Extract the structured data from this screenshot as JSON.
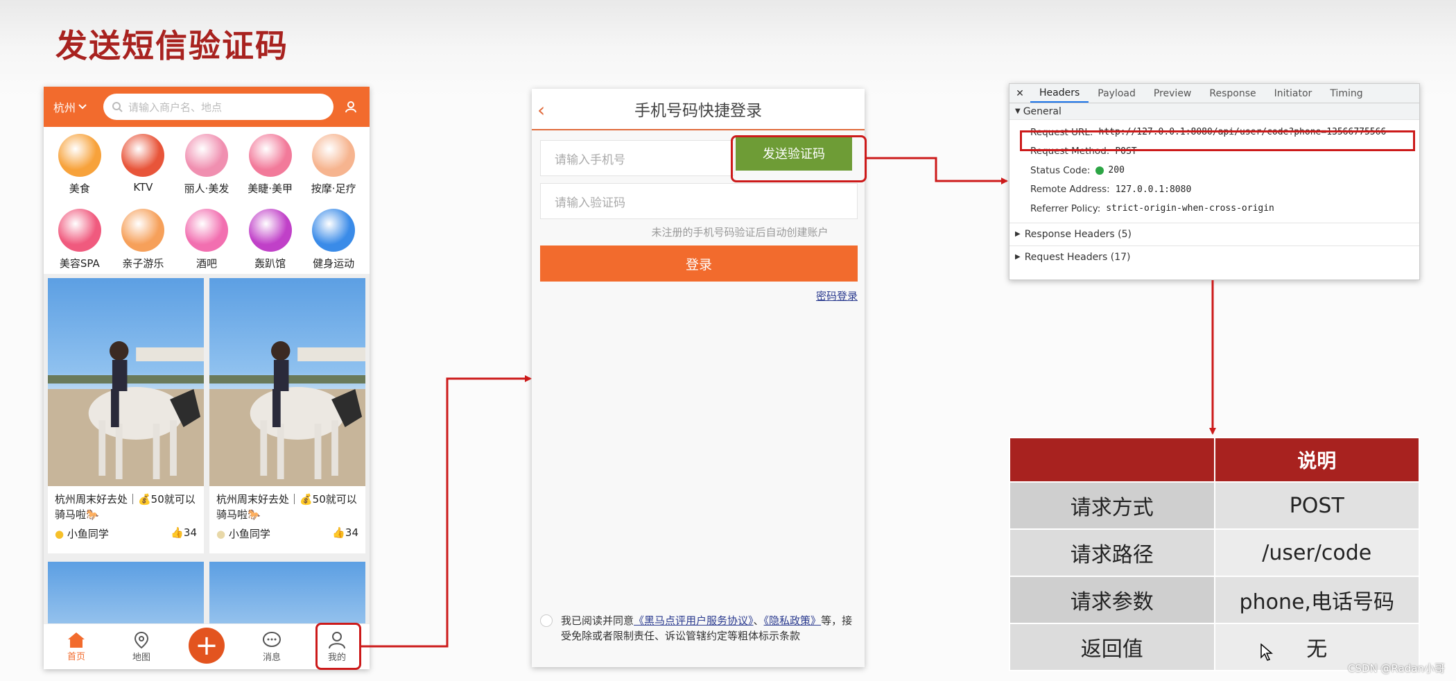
{
  "slide": {
    "title": "发送短信验证码"
  },
  "app_home": {
    "city": "杭州",
    "search_placeholder": "请输入商户名、地点",
    "categories": [
      {
        "label": "美食",
        "icon": "roast-chicken-icon",
        "color": "#f7a23b"
      },
      {
        "label": "KTV",
        "icon": "microphone-icon",
        "color": "#e8553a"
      },
      {
        "label": "丽人·美发",
        "icon": "hair-salon-icon",
        "color": "#f08fb0"
      },
      {
        "label": "美睫·美甲",
        "icon": "nail-icon",
        "color": "#f27a9a"
      },
      {
        "label": "按摩·足疗",
        "icon": "foot-massage-icon",
        "color": "#f6b48f"
      },
      {
        "label": "美容SPA",
        "icon": "face-mask-icon",
        "color": "#f05a7e"
      },
      {
        "label": "亲子游乐",
        "icon": "parent-child-icon",
        "color": "#f6a05a"
      },
      {
        "label": "酒吧",
        "icon": "cocktail-icon",
        "color": "#f26fb0"
      },
      {
        "label": "轰趴馆",
        "icon": "party-mask-icon",
        "color": "#c040c8"
      },
      {
        "label": "健身运动",
        "icon": "dumbbell-icon",
        "color": "#3a8be8"
      }
    ],
    "feed": [
      {
        "title": "杭州周末好去处｜💰50就可以骑马啦🐎",
        "author": "小鱼同学",
        "likes": "34"
      },
      {
        "title": "杭州周末好去处｜💰50就可以骑马啦🐎",
        "author": "小鱼同学",
        "likes": "34"
      }
    ],
    "tabs": [
      {
        "label": "首页",
        "icon": "home-icon"
      },
      {
        "label": "地图",
        "icon": "map-pin-icon"
      },
      {
        "label": "",
        "icon": "plus-icon"
      },
      {
        "label": "消息",
        "icon": "chat-bubble-icon"
      },
      {
        "label": "我的",
        "icon": "user-icon"
      }
    ]
  },
  "login": {
    "title": "手机号码快捷登录",
    "phone_placeholder": "请输入手机号",
    "send_code": "发送验证码",
    "code_placeholder": "请输入验证码",
    "note": "未注册的手机号码验证后自动创建账户",
    "login_button": "登录",
    "password_login": "密码登录",
    "agree_prefix": "我已阅读并同意",
    "agree_link1": "《黑马点评用户服务协议》",
    "agree_sep": "、",
    "agree_link2": "《隐私政策》",
    "agree_suffix": "等，接受免除或者限制责任、诉讼管辖约定等粗体标示条款"
  },
  "devtools": {
    "tabs": [
      "Headers",
      "Payload",
      "Preview",
      "Response",
      "Initiator",
      "Timing"
    ],
    "active_tab": "Headers",
    "general_label": "General",
    "rows": [
      {
        "key": "Request URL:",
        "value": "http://127.0.0.1:8080/api/user/code?phone=13566775566"
      },
      {
        "key": "Request Method:",
        "value": "POST"
      },
      {
        "key": "Status Code:",
        "value": "200"
      },
      {
        "key": "Remote Address:",
        "value": "127.0.0.1:8080"
      },
      {
        "key": "Referrer Policy:",
        "value": "strict-origin-when-cross-origin"
      }
    ],
    "response_headers": "Response Headers (5)",
    "request_headers": "Request Headers (17)"
  },
  "api_table": {
    "header": [
      "",
      "说明"
    ],
    "rows": [
      {
        "key": "请求方式",
        "value": "POST"
      },
      {
        "key": "请求路径",
        "value": "/user/code"
      },
      {
        "key": "请求参数",
        "value": "phone,电话号码"
      },
      {
        "key": "返回值",
        "value": "无"
      }
    ]
  },
  "watermark": "CSDN @Radan小哥",
  "colors": {
    "brand_orange": "#f26b2d",
    "send_green": "#6e9c36",
    "title_red": "#a8221f",
    "annotation_red": "#cc1a1a"
  }
}
